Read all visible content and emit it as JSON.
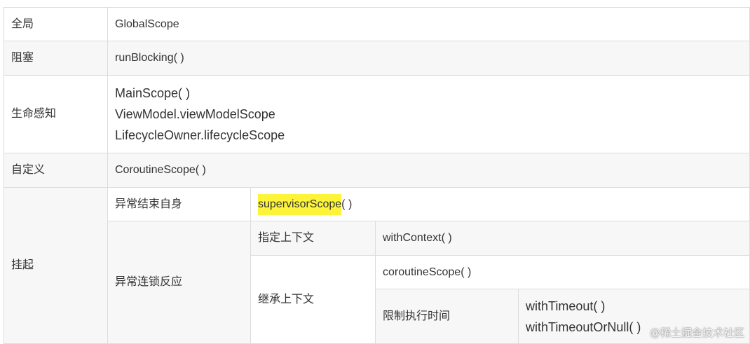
{
  "rows": {
    "global": {
      "label": "全局",
      "value": "GlobalScope"
    },
    "blocking": {
      "label": "阻塞",
      "value": "runBlocking( )"
    },
    "lifecycle": {
      "label": "生命感知",
      "values": [
        "MainScope( )",
        "ViewModel.viewModelScope",
        "LifecycleOwner.lifecycleScope"
      ]
    },
    "custom": {
      "label": "自定义",
      "value": "CoroutineScope( )"
    },
    "suspend": {
      "label": "挂起",
      "self_end": {
        "label": "异常结束自身",
        "value_highlight": "supervisorScope",
        "value_suffix": "( )"
      },
      "chain": {
        "label": "异常连锁反应",
        "specify": {
          "label": "指定上下文",
          "value": "withContext( )"
        },
        "inherit": {
          "label": "继承上下文",
          "value": "coroutineScope( )",
          "limit": {
            "label": "限制执行时间",
            "values": [
              "withTimeout( )",
              "withTimeoutOrNull( )"
            ]
          }
        }
      }
    }
  },
  "watermark": "@稀土掘金技术社区",
  "colors": {
    "highlight": "#fdf43a",
    "gray_row": "#f7f7f7",
    "border": "#dcdcdc"
  }
}
